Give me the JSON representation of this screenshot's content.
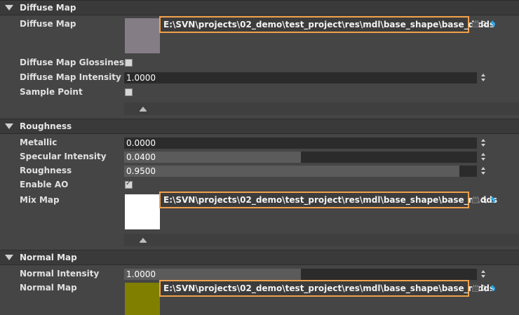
{
  "sections": {
    "diffuse": {
      "title": "Diffuse Map",
      "diffuse_map_label": "Diffuse Map",
      "diffuse_map_path": "E:\\SVN\\projects\\02_demo\\test_project\\res\\mdl\\base_shape\\base_d.dds",
      "diffuse_map_swatch_color": "#857d85",
      "glossiness_label": "Diffuse Map Glossiness",
      "glossiness_checked": false,
      "intensity_label": "Diffuse Map Intensity",
      "intensity_value": "1.0000",
      "intensity_fill": 0.0,
      "sample_point_label": "Sample Point",
      "sample_point_checked": false
    },
    "roughness": {
      "title": "Roughness",
      "metallic_label": "Metallic",
      "metallic_value": "0.0000",
      "metallic_fill": 0.0,
      "specular_label": "Specular Intensity",
      "specular_value": "0.0400",
      "specular_fill": 0.5,
      "roughness_label": "Roughness",
      "roughness_value": "0.9500",
      "roughness_fill": 0.95,
      "enable_ao_label": "Enable AO",
      "enable_ao_checked": true,
      "mix_map_label": "Mix Map",
      "mix_map_path": "E:\\SVN\\projects\\02_demo\\test_project\\res\\mdl\\base_shape\\base_m.dds",
      "mix_map_swatch_color": "#ffffff"
    },
    "normal": {
      "title": "Normal Map",
      "intensity_label": "Normal Intensity",
      "intensity_value": "1.0000",
      "intensity_fill": 0.5,
      "normal_map_label": "Normal Map",
      "normal_map_path": "E:\\SVN\\projects\\02_demo\\test_project\\res\\mdl\\base_shape\\base_n.dds",
      "normal_map_swatch_color": "#807f00"
    }
  },
  "colors": {
    "path_highlight": "#f0a04a",
    "reset_icon": "#2fa8e8"
  },
  "icons": {
    "section_toggle": "triangle-down-icon",
    "browse": "ellipsis-icon",
    "locate": "search-icon",
    "reset": "reset-icon",
    "collapse": "eject-up-icon",
    "spinner": "spinner-arrows-icon"
  }
}
